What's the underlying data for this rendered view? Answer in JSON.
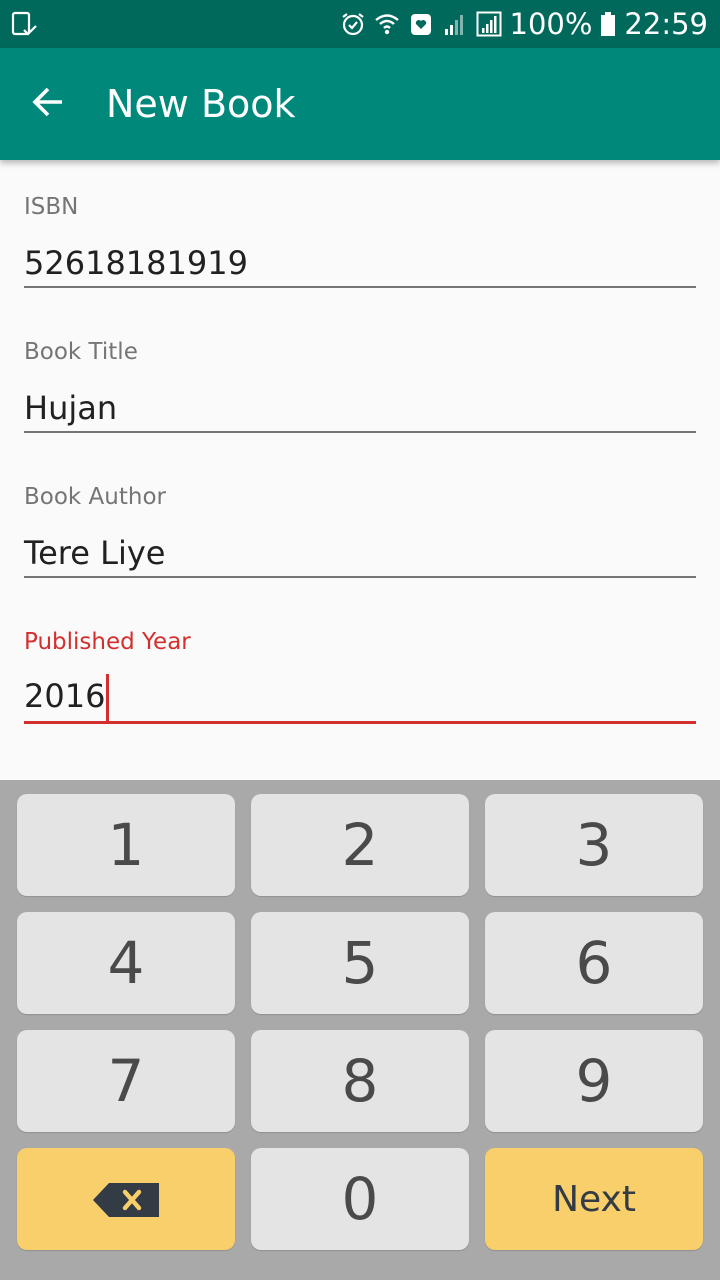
{
  "status_bar": {
    "battery_text": "100%",
    "time": "22:59",
    "left_icon": "screenshot-icon",
    "icons": [
      "alarm-icon",
      "wifi-icon",
      "heart-icon",
      "signal-icon",
      "signal-box-icon",
      "battery-icon"
    ]
  },
  "app_bar": {
    "title": "New Book",
    "back_icon": "arrow-left-icon"
  },
  "form": {
    "fields": [
      {
        "label": "ISBN",
        "value": "52618181919"
      },
      {
        "label": "Book Title",
        "value": "Hujan"
      },
      {
        "label": "Book Author",
        "value": "Tere Liye"
      },
      {
        "label": "Published Year",
        "value": "2016",
        "focused": true
      }
    ]
  },
  "keypad": {
    "keys": [
      "1",
      "2",
      "3",
      "4",
      "5",
      "6",
      "7",
      "8",
      "9",
      "0"
    ],
    "next_label": "Next",
    "backspace_icon": "backspace-icon"
  },
  "colors": {
    "status_bar": "#00695c",
    "app_bar": "#00897b",
    "focus_accent": "#d32f2f",
    "key_background": "#e4e4e4",
    "key_accent": "#f8cf6b",
    "keypad_background": "#a9a9a9"
  }
}
